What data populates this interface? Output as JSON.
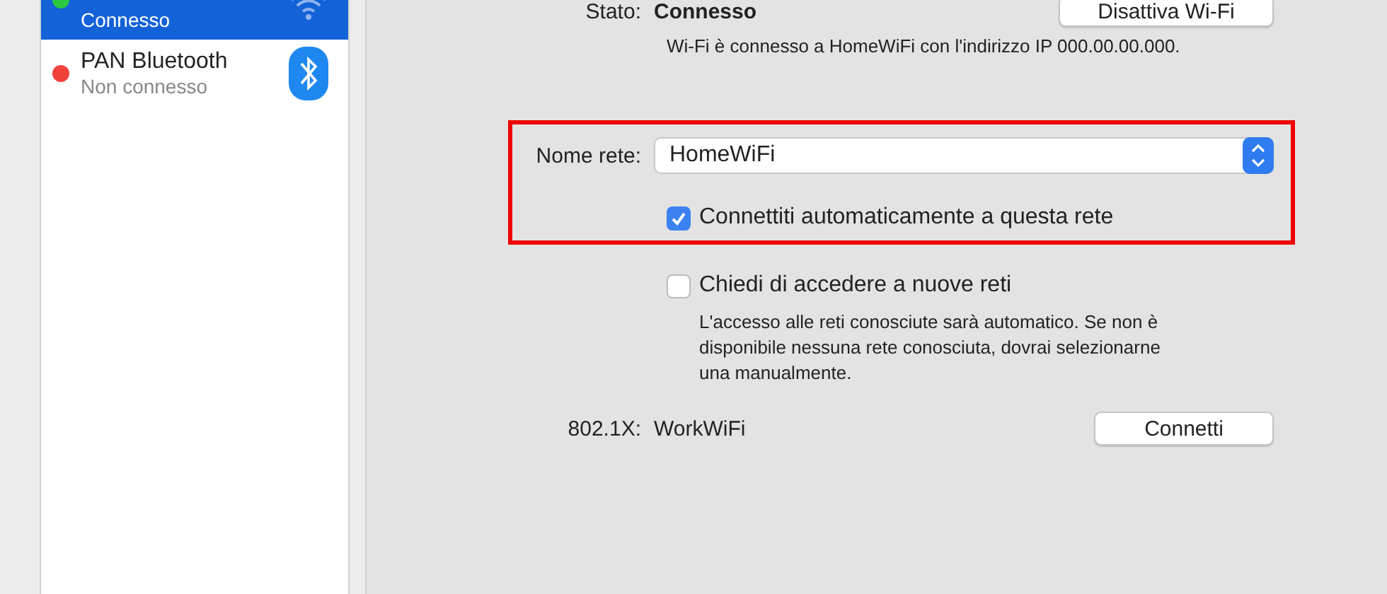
{
  "sidebar": {
    "items": [
      {
        "kind": "wifi",
        "status": "Connesso",
        "selected": true,
        "color": "#2ac840"
      },
      {
        "kind": "bluetooth",
        "name": "PAN Bluetooth",
        "status": "Non connesso",
        "selected": false,
        "color": "#f0403a"
      }
    ]
  },
  "status": {
    "label": "Stato:",
    "value": "Connesso",
    "button": "Disattiva Wi-Fi",
    "info": "Wi-Fi è connesso a HomeWiFi con l'indirizzo IP 000.00.00.000."
  },
  "network_name": {
    "label": "Nome rete:",
    "value": "HomeWiFi"
  },
  "options": [
    {
      "label": "Connettiti automaticamente a questa rete",
      "checked": true
    },
    {
      "label": "Chiedi di accedere a nuove reti",
      "checked": false,
      "note": "L'accesso alle reti conosciute sarà automatico. Se non è disponibile nessuna rete conosciuta, dovrai selezionarne una manualmente."
    }
  ],
  "dot1x": {
    "label": "802.1X:",
    "value": "WorkWiFi",
    "button": "Connetti"
  }
}
